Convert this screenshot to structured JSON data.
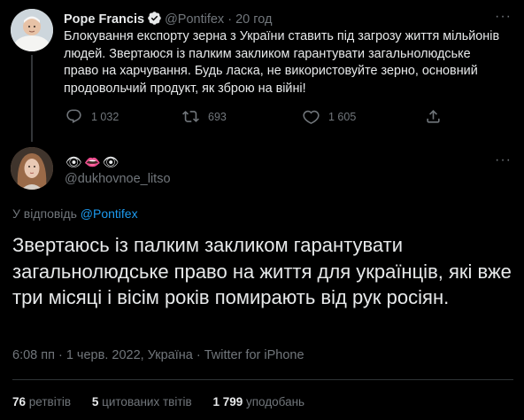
{
  "parent_tweet": {
    "name": "Pope Francis",
    "handle": "@Pontifex",
    "time": "20 год",
    "text": "Блокування експорту зерна з України ставить під загрозу життя мільйонів людей. Звертаюся із палким закликом гарантувати загальнолюдське право на харчування. Будь ласка, не використовуйте зерно, основний продовольчий продукт, як зброю на війні!",
    "replies": "1 032",
    "retweets": "693",
    "likes": "1 605",
    "icons": [
      "verified-badge-icon",
      "reply-icon",
      "retweet-icon",
      "like-icon",
      "share-icon",
      "more-icon"
    ]
  },
  "reply_tweet": {
    "display_name_emoji": "👁👄👁",
    "handle": "@dukhovnoe_litso",
    "replying_prefix": "У відповідь",
    "replying_to": "@Pontifex",
    "text": "Звертаюсь із палким закликом гарантувати загальнолюдське право на життя для українців, які вже три місяці і вісім років помирають від рук росіян.",
    "meta": "6:08 пп · 1 черв. 2022, Україна · Twitter for iPhone",
    "stats": {
      "retweets_count": "76",
      "retweets_label": "ретвітів",
      "quotes_count": "5",
      "quotes_label": "цитованих твітів",
      "likes_count": "1 799",
      "likes_label": "уподобань"
    }
  },
  "colors": {
    "background": "#000000",
    "text": "#e7e9ea",
    "muted": "#71767b",
    "accent": "#1d9bf0",
    "separator": "#2f3336"
  }
}
